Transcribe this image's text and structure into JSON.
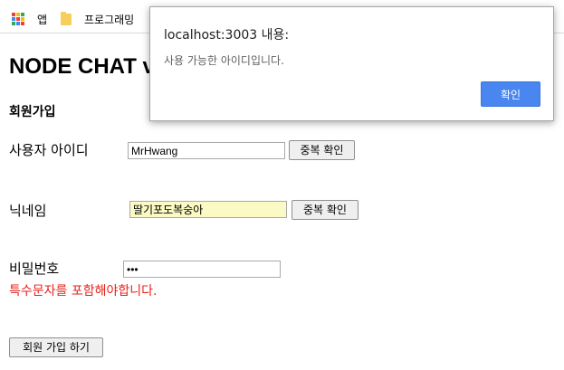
{
  "bookmarks_bar": {
    "apps_label": "앱",
    "folder_label": "프로그래밍",
    "apps_icon_colors": [
      "#ea4335",
      "#fbbc05",
      "#34a853",
      "#4285f4",
      "#ea4335",
      "#fbbc05",
      "#34a853",
      "#4285f4",
      "#ea4335"
    ]
  },
  "page": {
    "title": "NODE CHAT v",
    "section_title": "회원가입",
    "user_id": {
      "label": "사용자 아이디",
      "value": "MrHwang",
      "check_button": "중복 확인"
    },
    "nickname": {
      "label": "닉네임",
      "value": "딸기포도복숭아",
      "check_button": "중복 확인"
    },
    "password": {
      "label": "비밀번호",
      "value": "•••",
      "warning": "특수문자를 포함해야합니다."
    },
    "signup_button": "회원 가입 하기"
  },
  "dialog": {
    "title": "localhost:3003 내용:",
    "message": "사용 가능한 아이디입니다.",
    "ok_button": "확인"
  },
  "colors": {
    "warning": "#e8221a",
    "dialog_ok": "#4a86f0",
    "autofill": "#fbf9c4"
  }
}
